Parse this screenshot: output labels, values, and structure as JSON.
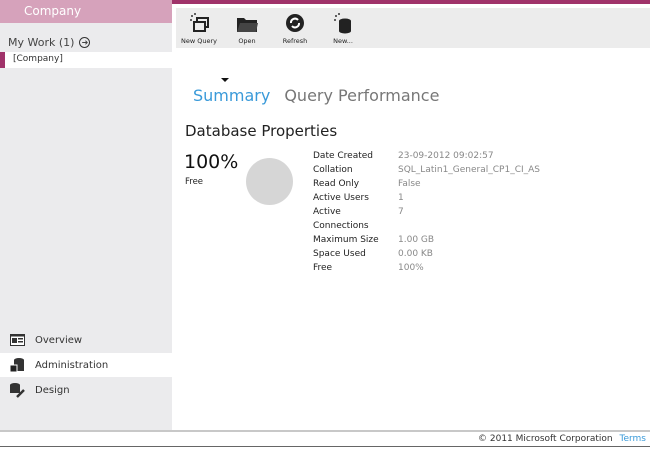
{
  "sidebar": {
    "brand": "Company",
    "my_work": "My Work (1)",
    "company_item": "[Company]",
    "nav": [
      {
        "label": "Overview",
        "icon": "overview-icon"
      },
      {
        "label": "Administration",
        "icon": "administration-icon"
      },
      {
        "label": "Design",
        "icon": "design-icon"
      }
    ]
  },
  "toolbar": {
    "new_query": "New Query",
    "open": "Open",
    "refresh": "Refresh",
    "new": "New..."
  },
  "tabs": {
    "summary": "Summary",
    "query_performance": "Query Performance"
  },
  "main": {
    "title": "Database Properties",
    "free_pct": "100%",
    "free_label": "Free",
    "properties": [
      {
        "k": "Date Created",
        "v": "23-09-2012 09:02:57"
      },
      {
        "k": "Collation",
        "v": "SQL_Latin1_General_CP1_CI_AS"
      },
      {
        "k": "Read Only",
        "v": "False"
      },
      {
        "k": "Active Users",
        "v": "1"
      },
      {
        "k": "Active Connections",
        "v": "7"
      },
      {
        "k": "Maximum Size",
        "v": "1.00 GB"
      },
      {
        "k": "Space Used",
        "v": "0.00 KB"
      },
      {
        "k": "Free",
        "v": "100%"
      }
    ]
  },
  "footer": {
    "copyright": "© 2011 Microsoft Corporation",
    "terms": "Terms"
  },
  "colors": {
    "accent": "#a0336a",
    "link": "#3a9ad9",
    "brand_bg": "#d6a2bb"
  }
}
